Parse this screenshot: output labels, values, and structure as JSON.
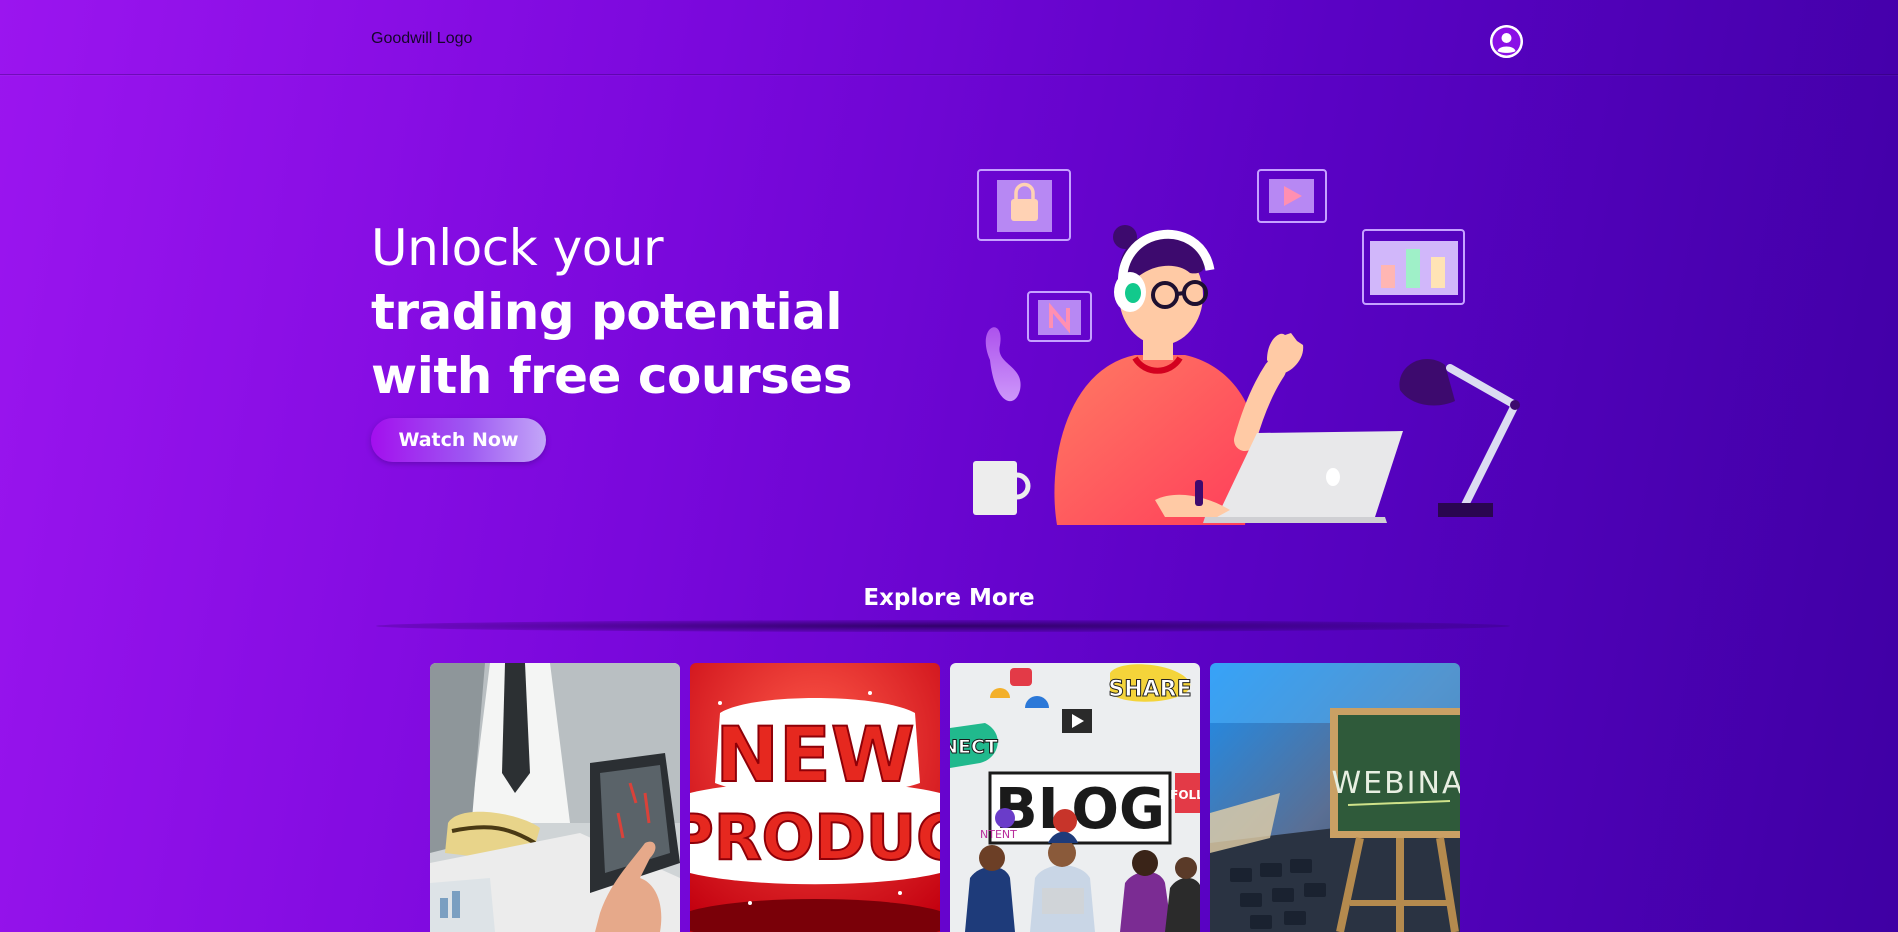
{
  "nav": {
    "logo": "Goodwill Logo"
  },
  "hero": {
    "line1": "Unlock your",
    "line2": "trading potential",
    "line3": "with free courses",
    "button": "Watch Now"
  },
  "explore": {
    "title": "Explore More"
  },
  "cards": [
    {
      "name": "trading"
    },
    {
      "name": "new-product",
      "text1": "NEW",
      "text2": "PRODUC"
    },
    {
      "name": "blog",
      "text": "BLOG",
      "share": "SHARE",
      "nect": "NECT",
      "foll": "FOLL",
      "ntent": "NTENT"
    },
    {
      "name": "webinar",
      "text": "WEBINA"
    }
  ],
  "colors": {
    "accent": "#9b15ef",
    "brand_dark": "#3f00a4"
  }
}
